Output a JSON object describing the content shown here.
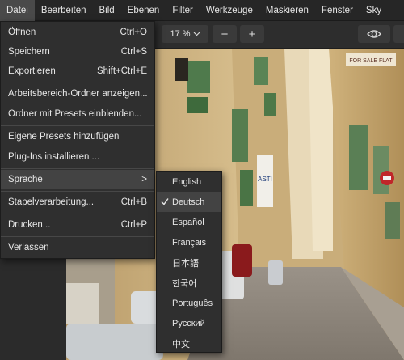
{
  "menubar": {
    "items": [
      "Datei",
      "Bearbeiten",
      "Bild",
      "Ebenen",
      "Filter",
      "Werkzeuge",
      "Maskieren",
      "Fenster",
      "Sky"
    ]
  },
  "toolbar": {
    "zoom": "17 %",
    "zoom_out": "−",
    "zoom_in": "+"
  },
  "file_menu": {
    "items": [
      {
        "label": "Öffnen",
        "shortcut": "Ctrl+O"
      },
      {
        "label": "Speichern",
        "shortcut": "Ctrl+S"
      },
      {
        "label": "Exportieren",
        "shortcut": "Shift+Ctrl+E"
      },
      {
        "label": "Arbeitsbereich-Ordner anzeigen...",
        "shortcut": ""
      },
      {
        "label": "Ordner mit Presets einblenden...",
        "shortcut": ""
      },
      {
        "label": "Eigene Presets hinzufügen",
        "shortcut": ""
      },
      {
        "label": "Plug-Ins installieren ...",
        "shortcut": ""
      },
      {
        "label": "Sprache",
        "shortcut": ">"
      },
      {
        "label": "Stapelverarbeitung...",
        "shortcut": "Ctrl+B"
      },
      {
        "label": "Drucken...",
        "shortcut": "Ctrl+P"
      },
      {
        "label": "Verlassen",
        "shortcut": ""
      }
    ]
  },
  "language_menu": {
    "items": [
      "English",
      "Deutsch",
      "Español",
      "Français",
      "日本語",
      "한국어",
      "Português",
      "Русский",
      "中文"
    ],
    "selected": "Deutsch"
  },
  "canvas": {
    "signs": [
      "FOR SALE FLAT",
      "ASTI"
    ]
  },
  "colors": {
    "menubar_bg": "#262626",
    "menu_bg": "#2f2f2f",
    "highlight": "#434343",
    "text": "#e6e6e6"
  }
}
